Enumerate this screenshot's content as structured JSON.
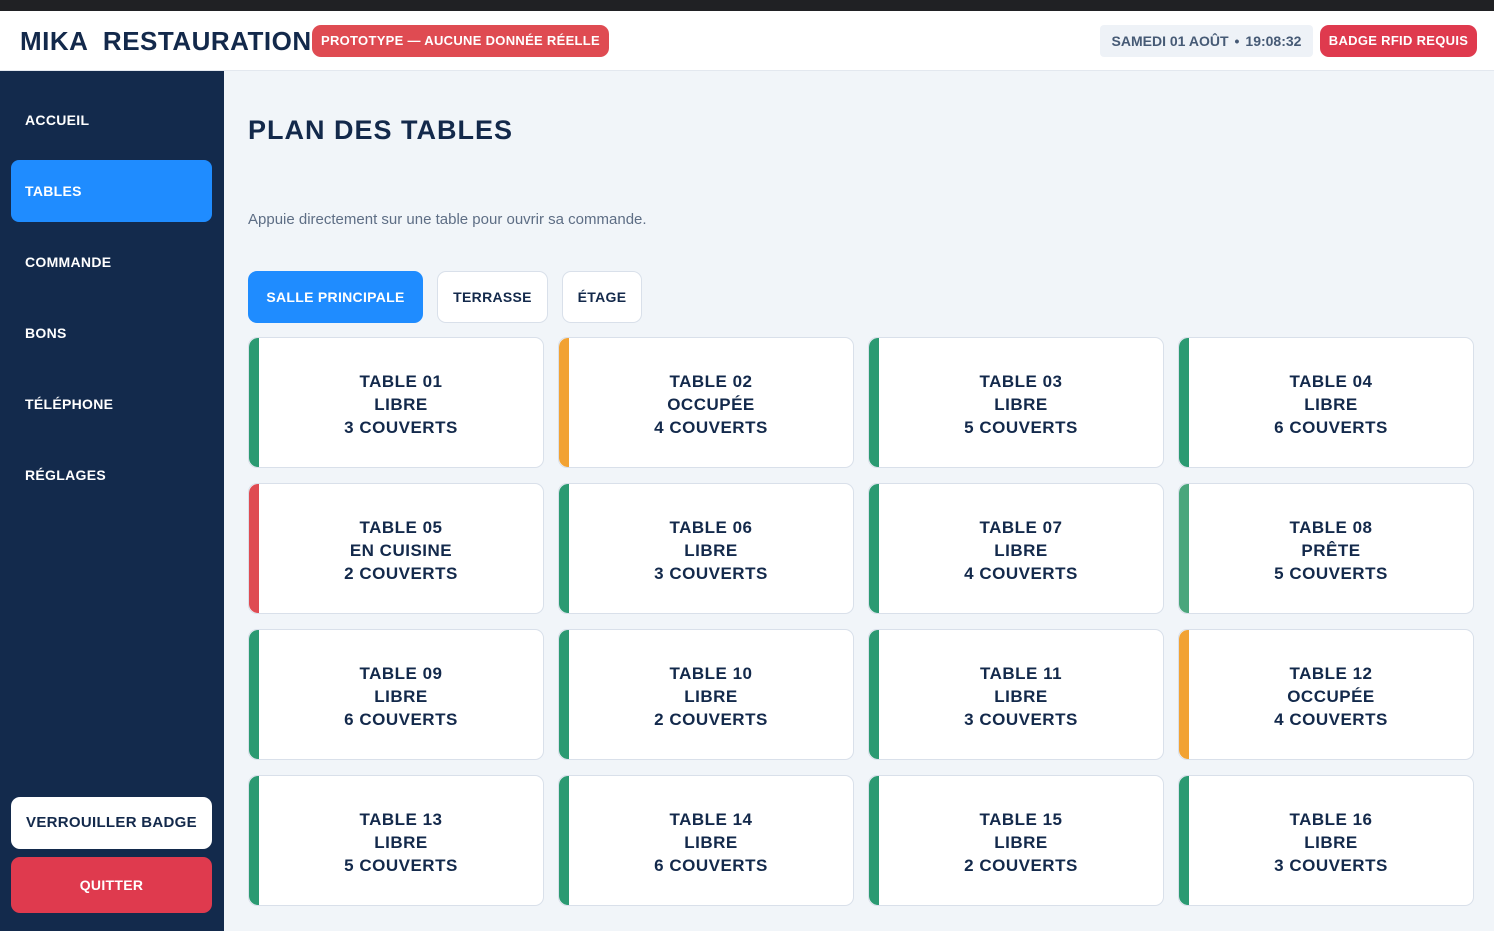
{
  "header": {
    "brand": "MIKA  RESTAURATION",
    "prototype_badge": "PROTOTYPE — AUCUNE DONNÉE RÉELLE",
    "date": "SAMEDI 01 AOÛT",
    "separator": "•",
    "time": "19:08:32",
    "rfid_button": "BADGE RFID REQUIS"
  },
  "sidebar": {
    "items": [
      {
        "label": "ACCUEIL",
        "active": false
      },
      {
        "label": "TABLES",
        "active": true
      },
      {
        "label": "COMMANDE",
        "active": false
      },
      {
        "label": "BONS",
        "active": false
      },
      {
        "label": "TÉLÉPHONE",
        "active": false
      },
      {
        "label": "RÉGLAGES",
        "active": false
      }
    ],
    "lock_button": "VERROUILLER BADGE",
    "quit_button": "QUITTER"
  },
  "main": {
    "title": "PLAN DES TABLES",
    "subtitle": "Appuie directement sur une table pour ouvrir sa commande.",
    "zones": [
      {
        "label": "SALLE PRINCIPALE",
        "active": true
      },
      {
        "label": "TERRASSE",
        "active": false
      },
      {
        "label": "ÉTAGE",
        "active": false
      }
    ],
    "tables": [
      {
        "name": "TABLE 01",
        "status": "LIBRE",
        "covers": "3 COUVERTS",
        "color": "#2b9a72"
      },
      {
        "name": "TABLE 02",
        "status": "OCCUPÉE",
        "covers": "4 COUVERTS",
        "color": "#f2a233"
      },
      {
        "name": "TABLE 03",
        "status": "LIBRE",
        "covers": "5 COUVERTS",
        "color": "#2b9a72"
      },
      {
        "name": "TABLE 04",
        "status": "LIBRE",
        "covers": "6 COUVERTS",
        "color": "#2b9a72"
      },
      {
        "name": "TABLE 05",
        "status": "EN CUISINE",
        "covers": "2 COUVERTS",
        "color": "#df4b52"
      },
      {
        "name": "TABLE 06",
        "status": "LIBRE",
        "covers": "3 COUVERTS",
        "color": "#2b9a72"
      },
      {
        "name": "TABLE 07",
        "status": "LIBRE",
        "covers": "4 COUVERTS",
        "color": "#2b9a72"
      },
      {
        "name": "TABLE 08",
        "status": "PRÊTE",
        "covers": "5 COUVERTS",
        "color": "#4aa67c"
      },
      {
        "name": "TABLE 09",
        "status": "LIBRE",
        "covers": "6 COUVERTS",
        "color": "#2b9a72"
      },
      {
        "name": "TABLE 10",
        "status": "LIBRE",
        "covers": "2 COUVERTS",
        "color": "#2b9a72"
      },
      {
        "name": "TABLE 11",
        "status": "LIBRE",
        "covers": "3 COUVERTS",
        "color": "#2b9a72"
      },
      {
        "name": "TABLE 12",
        "status": "OCCUPÉE",
        "covers": "4 COUVERTS",
        "color": "#f2a233"
      },
      {
        "name": "TABLE 13",
        "status": "LIBRE",
        "covers": "5 COUVERTS",
        "color": "#2b9a72"
      },
      {
        "name": "TABLE 14",
        "status": "LIBRE",
        "covers": "6 COUVERTS",
        "color": "#2b9a72"
      },
      {
        "name": "TABLE 15",
        "status": "LIBRE",
        "covers": "2 COUVERTS",
        "color": "#2b9a72"
      },
      {
        "name": "TABLE 16",
        "status": "LIBRE",
        "covers": "3 COUVERTS",
        "color": "#2b9a72"
      }
    ]
  }
}
